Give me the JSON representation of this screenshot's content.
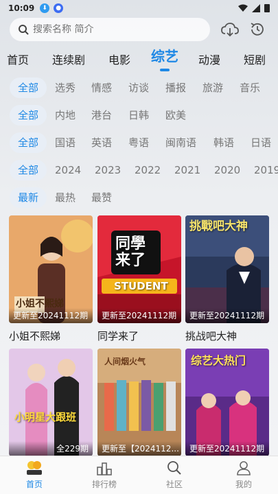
{
  "status_bar": {
    "time": "10:09"
  },
  "search": {
    "placeholder": "搜索名称 简介"
  },
  "main_tabs": [
    "首页",
    "连续剧",
    "电影",
    "综艺",
    "动漫",
    "短剧"
  ],
  "filters": {
    "type": [
      "全部",
      "选秀",
      "情感",
      "访谈",
      "播报",
      "旅游",
      "音乐"
    ],
    "region": [
      "全部",
      "内地",
      "港台",
      "日韩",
      "欧美"
    ],
    "language": [
      "全部",
      "国语",
      "英语",
      "粤语",
      "闽南语",
      "韩语",
      "日语"
    ],
    "year": [
      "全部",
      "2024",
      "2023",
      "2022",
      "2021",
      "2020",
      "2019"
    ],
    "sort": [
      "最新",
      "最热",
      "最赞"
    ]
  },
  "shows": [
    {
      "title": "小姐不熙娣",
      "badge": "更新至20241112期",
      "poster_text": "小姐不熙娣"
    },
    {
      "title": "同学来了",
      "badge": "更新至20241112期",
      "poster_text": "同學来了"
    },
    {
      "title": "挑战吧大神",
      "badge": "更新至20241112期",
      "poster_text": "挑戰吧大神"
    },
    {
      "title": "",
      "badge": "全229期",
      "poster_text": "小明星大跟班"
    },
    {
      "title": "",
      "badge": "更新至【2024112...",
      "poster_text": "人间烟火气"
    },
    {
      "title": "",
      "badge": "更新至20241112期",
      "poster_text": "综艺大热门"
    }
  ],
  "bottom_nav": [
    {
      "label": "首页",
      "icon": "home-logo-icon"
    },
    {
      "label": "排行榜",
      "icon": "ranking-icon"
    },
    {
      "label": "社区",
      "icon": "search-community-icon"
    },
    {
      "label": "我的",
      "icon": "user-icon"
    }
  ],
  "colors": {
    "accent": "#1e88e5"
  }
}
